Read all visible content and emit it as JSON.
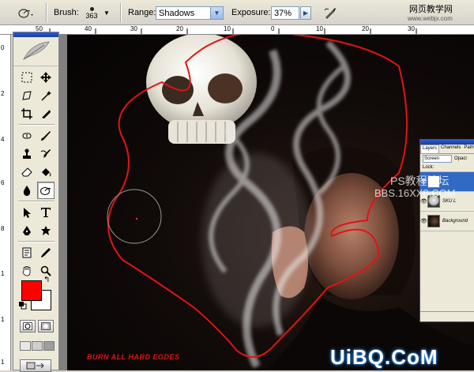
{
  "options_bar": {
    "brush_label": "Brush:",
    "brush_size": "363",
    "range_label": "Range:",
    "range_value": "Shadows",
    "exposure_label": "Exposure:",
    "exposure_value": "37%",
    "tool_icon": "dodge-burn-icon",
    "airbrush_icon": "airbrush-icon"
  },
  "site_watermark": {
    "line1": "网页教学网",
    "line2": "www.webjx.com"
  },
  "ruler_top": [
    "50",
    "40",
    "30",
    "20",
    "10",
    "0",
    "10",
    "20",
    "30"
  ],
  "ruler_left": [
    "0",
    "2",
    "4",
    "6",
    "8",
    "1",
    "1",
    "1",
    "1",
    "1"
  ],
  "toolbox": {
    "active_tool": "burn-tool",
    "foreground_color": "#ff0000",
    "background_color": "#ffffff",
    "tools": [
      "marquee-icon",
      "move-icon",
      "lasso-icon",
      "magic-wand-icon",
      "crop-icon",
      "slice-icon",
      "healing-brush-icon",
      "brush-icon",
      "clone-stamp-icon",
      "history-brush-icon",
      "eraser-icon",
      "paint-bucket-icon",
      "blur-icon",
      "burn-icon",
      "path-selection-icon",
      "type-icon",
      "pen-icon",
      "custom-shape-icon",
      "notes-icon",
      "eyedropper-icon",
      "hand-icon",
      "zoom-icon"
    ]
  },
  "canvas": {
    "caption": "BURN ALL HARD EGDES",
    "accent_color": "#e01414"
  },
  "layers_panel": {
    "tabs": [
      "Layers",
      "Channels",
      "Paths"
    ],
    "blend_mode": "Screen",
    "opacity_label": "Opaci",
    "lock_label": "Lock:",
    "layers": [
      {
        "name": "",
        "active": true
      },
      {
        "name": "SKU L",
        "active": false
      },
      {
        "name": "Background",
        "active": false
      }
    ]
  },
  "watermarks": {
    "ps_forum": "PS教程论坛",
    "bbs": "BBS.16XX8.COM",
    "uibq": "UiBQ.CoM"
  }
}
